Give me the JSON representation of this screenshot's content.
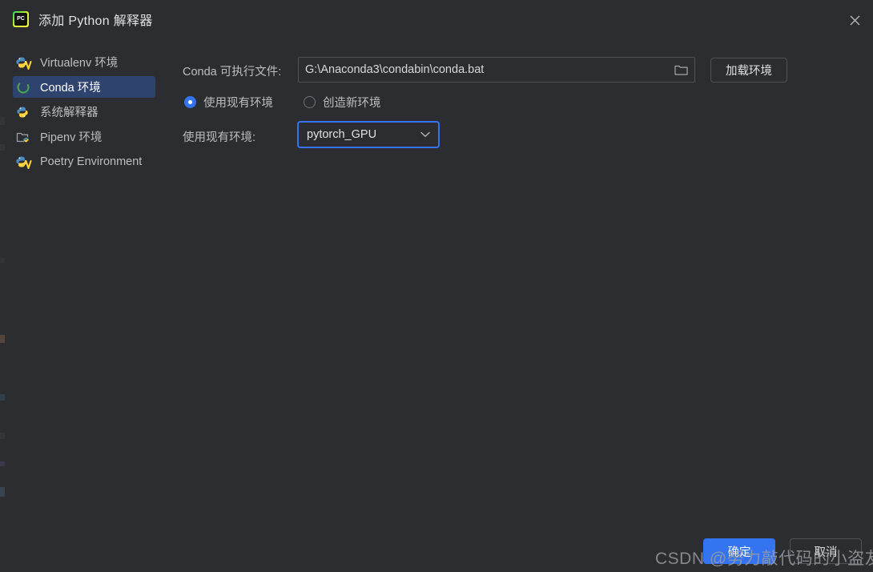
{
  "window": {
    "title": "添加 Python 解释器",
    "logo_icon": "pycharm-logo-icon",
    "logo_text": "PC",
    "close_icon": "close-icon"
  },
  "sidebar": {
    "items": [
      {
        "label": "Virtualenv 环境",
        "icon": "python-virtualenv-icon",
        "selected": false
      },
      {
        "label": "Conda 环境",
        "icon": "conda-ring-icon",
        "selected": true
      },
      {
        "label": "系统解释器",
        "icon": "python-icon",
        "selected": false
      },
      {
        "label": "Pipenv 环境",
        "icon": "pipenv-folder-icon",
        "selected": false
      },
      {
        "label": "Poetry Environment",
        "icon": "python-poetry-icon",
        "selected": false
      }
    ]
  },
  "main": {
    "conda_path_label": "Conda 可执行文件:",
    "conda_path_value": "G:\\Anaconda3\\condabin\\conda.bat",
    "browse_icon": "folder-icon",
    "load_env_button": "加载环境",
    "radio_options": [
      {
        "label": "使用现有环境",
        "checked": true
      },
      {
        "label": "创造新环境",
        "checked": false
      }
    ],
    "existing_env_label": "使用现有环境:",
    "existing_env_value": "pytorch_GPU",
    "dropdown_caret_icon": "chevron-down-icon"
  },
  "footer": {
    "ok_label": "确定",
    "cancel_label": "取消"
  },
  "watermark": {
    "text": "CSDN @努力敲代码的小盗友"
  },
  "colors": {
    "background": "#2b2d30",
    "accent": "#3574f0",
    "selection": "#2e436e",
    "border": "#4e5157",
    "text": "#dfe1e5",
    "muted_text": "#bcbec4"
  }
}
